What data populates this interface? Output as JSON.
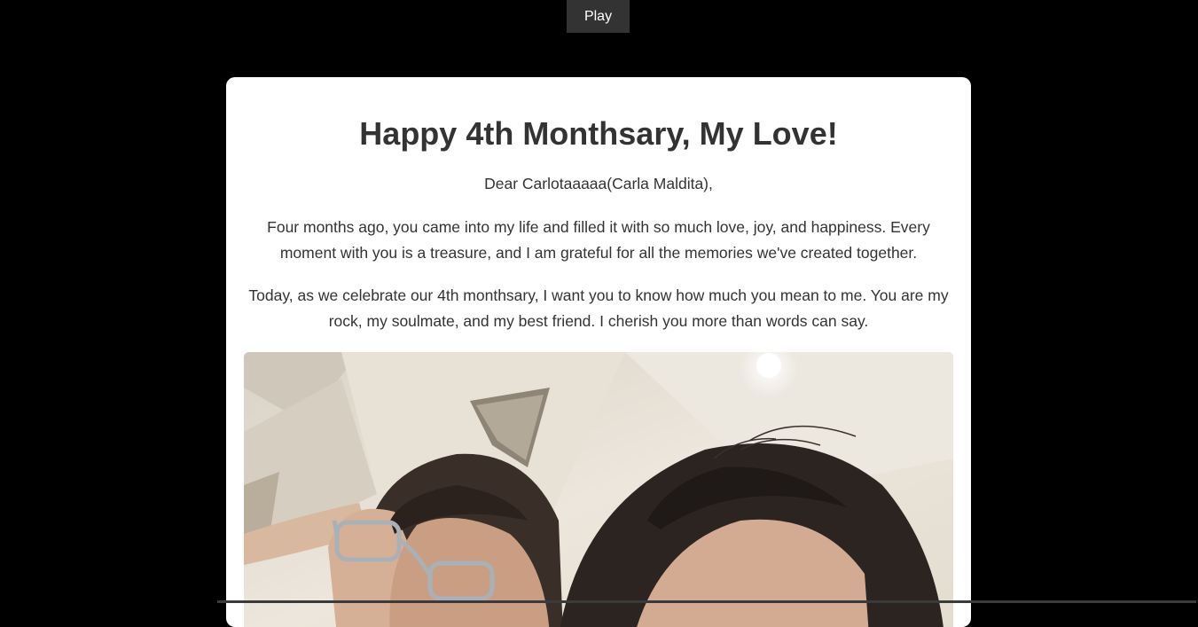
{
  "player": {
    "play_label": "Play"
  },
  "letter": {
    "title": "Happy 4th Monthsary, My Love!",
    "salutation": "Dear Carlotaaaaa(Carla Maldita),",
    "paragraphs": [
      "Four months ago, you came into my life and filled it with so much love, joy, and happiness. Every moment with you is a treasure, and I am grateful for all the memories we've created together.",
      "Today, as we celebrate our 4th monthsary, I want you to know how much you mean to me. You are my rock, my soulmate, and my best friend. I cherish you more than words can say."
    ]
  },
  "colors": {
    "page_background": "#000000",
    "card_background": "#ffffff",
    "text": "#333333",
    "play_button_background": "#333333",
    "play_button_text": "#ffffff"
  }
}
